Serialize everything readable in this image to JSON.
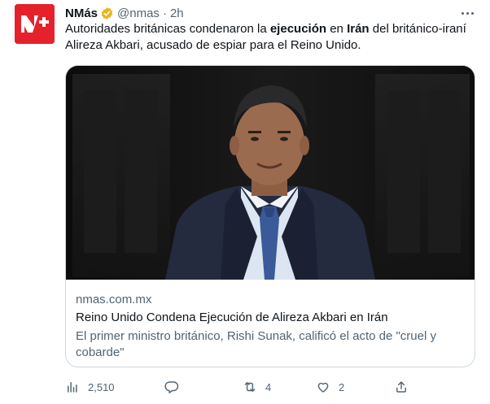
{
  "account": {
    "name": "NMás",
    "handle": "@nmas",
    "separator": "·",
    "time": "2h",
    "avatar_text": "N+",
    "brand_color": "#e5222b",
    "verified_color": "#e8b61d",
    "verified_icon": "verified-badge-icon"
  },
  "tweet": {
    "text_part1": "Autoridades británicas condenaron la ",
    "text_bold1": "ejecución",
    "text_part2": " en ",
    "text_bold2": "Irán",
    "text_part3": " del británico-iraní Alireza Akbari, acusado de espiar para el Reino Unido."
  },
  "card": {
    "domain": "nmas.com.mx",
    "title": "Reino Unido Condena Ejecución de Alireza Akbari en Irán",
    "description": "El primer ministro británico, Rishi Sunak, calificó el acto de \"cruel y cobarde\""
  },
  "actions": {
    "views_icon": "bar-chart-icon",
    "views_count": "2,510",
    "reply_icon": "reply-icon",
    "retweet_icon": "retweet-icon",
    "retweet_count": "4",
    "like_icon": "heart-icon",
    "like_count": "2",
    "share_icon": "share-icon"
  }
}
